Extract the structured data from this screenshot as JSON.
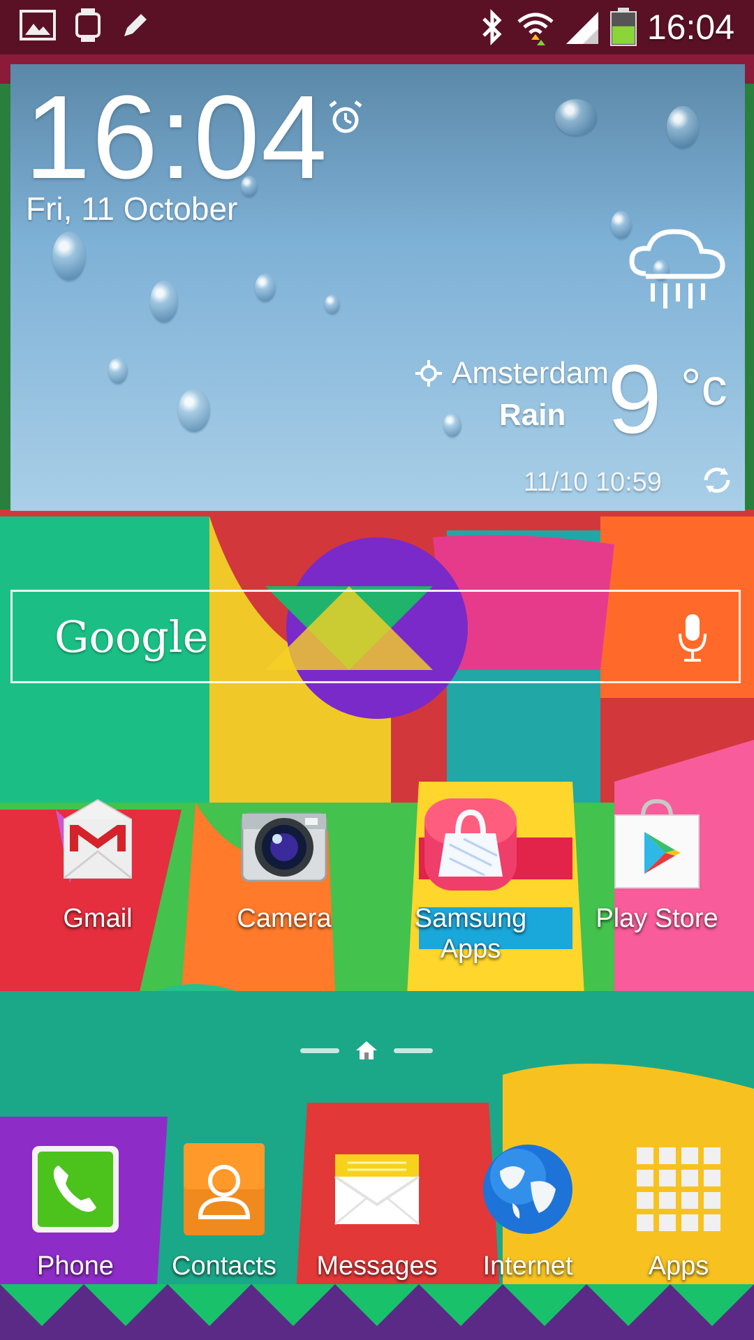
{
  "status_bar": {
    "time": "16:04",
    "left_icons": [
      "gallery-icon",
      "watch-icon",
      "pencil-icon"
    ],
    "right_icons": [
      "bluetooth-icon",
      "wifi-icon",
      "signal-icon",
      "battery-icon"
    ],
    "battery_level": 0.55
  },
  "weather_widget": {
    "time": "16:04",
    "date": "Fri, 11 October",
    "city": "Amsterdam",
    "condition": "Rain",
    "temperature": "9",
    "unit": "°c",
    "updated": "11/10 10:59",
    "icon": "rain-cloud-icon"
  },
  "search_bar": {
    "logo": "Google",
    "mic_icon": "mic-icon"
  },
  "home_apps": [
    {
      "label": "Gmail",
      "icon": "gmail-icon"
    },
    {
      "label": "Camera",
      "icon": "camera-icon"
    },
    {
      "label": "Samsung Apps",
      "icon": "samsung-apps-icon"
    },
    {
      "label": "Play Store",
      "icon": "play-store-icon"
    }
  ],
  "dock": [
    {
      "label": "Phone",
      "icon": "phone-icon"
    },
    {
      "label": "Contacts",
      "icon": "contacts-icon"
    },
    {
      "label": "Messages",
      "icon": "messages-icon"
    },
    {
      "label": "Internet",
      "icon": "internet-icon"
    },
    {
      "label": "Apps",
      "icon": "apps-grid-icon"
    }
  ]
}
